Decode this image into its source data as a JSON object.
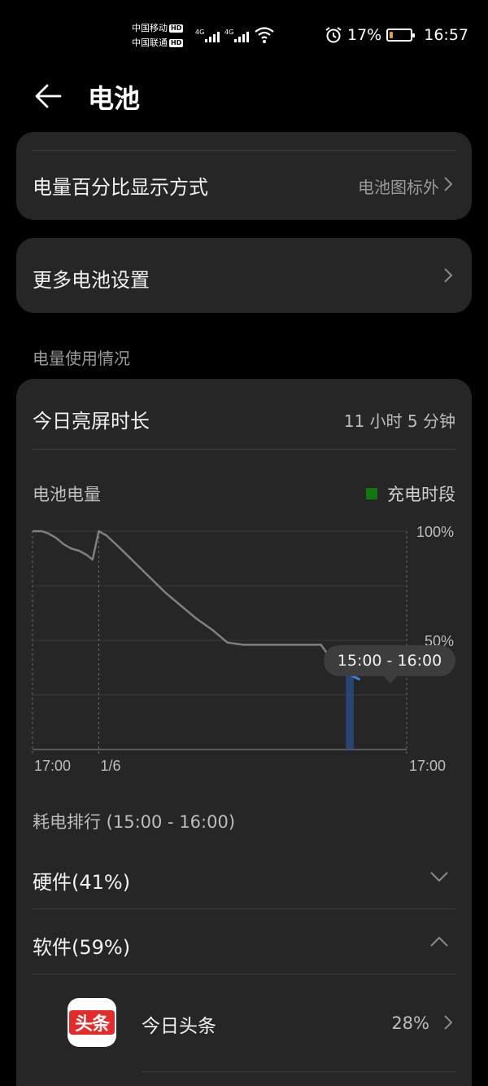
{
  "status_bar": {
    "carrier1": "中国移动",
    "carrier2": "中国联通",
    "hd_badge": "HD",
    "net_type1": "4G",
    "net_type2": "4G",
    "battery_pct": "17%",
    "battery_level": 0.17,
    "time": "16:57",
    "icons": [
      "signal-icon",
      "wifi-icon",
      "alarm-icon",
      "battery-icon"
    ]
  },
  "header": {
    "title": "电池",
    "back_icon": "back-arrow-icon"
  },
  "settings": {
    "percent_display_label": "电量百分比显示方式",
    "percent_display_value": "电池图标外",
    "more_settings_label": "更多电池设置"
  },
  "usage_section_title": "电量使用情况",
  "usage": {
    "screen_time_label": "今日亮屏时长",
    "screen_time_value": "11 小时 5 分钟",
    "chart_title": "电池电量",
    "legend_label": "充电时段",
    "tooltip": "15:00 - 16:00",
    "ranking_title": "耗电排行 (15:00 - 16:00)",
    "hardware_label": "硬件(41%)",
    "software_label": "软件(59%)",
    "apps": [
      {
        "name": "今日头条",
        "percent": "28%",
        "icon_text": "头条"
      }
    ]
  },
  "colors": {
    "background": "#000000",
    "card": "#262626",
    "charging_legend": "#0e7a0e",
    "highlight": "#2f6fd6",
    "battery_fill": "#f0a020"
  },
  "chart_data": {
    "type": "line",
    "title": "电池电量",
    "x_tick_labels": [
      "17:00",
      "1/6",
      "17:00"
    ],
    "y_tick_labels": [
      "100%",
      "50%"
    ],
    "ylim": [
      0,
      100
    ],
    "x_unit": "hours since 17:00 previous day",
    "series": [
      {
        "values": [
          [
            0,
            100
          ],
          [
            1.2,
            100
          ],
          [
            2,
            99
          ],
          [
            3,
            97
          ],
          [
            4,
            94
          ],
          [
            5,
            92
          ],
          [
            6,
            91
          ],
          [
            7,
            89
          ],
          [
            7.7,
            87
          ],
          [
            8.5,
            100
          ],
          [
            9.5,
            98
          ],
          [
            11,
            93
          ],
          [
            13,
            86
          ],
          [
            15,
            79
          ],
          [
            17,
            72
          ],
          [
            19,
            66
          ],
          [
            21,
            60
          ],
          [
            23,
            55
          ],
          [
            25,
            49
          ],
          [
            27,
            48
          ],
          [
            30,
            48
          ],
          [
            34,
            48
          ],
          [
            37,
            48
          ],
          [
            38.2,
            42
          ],
          [
            39,
            40
          ],
          [
            40,
            37
          ],
          [
            40.9,
            34
          ],
          [
            42,
            32
          ]
        ]
      }
    ],
    "highlight_range": [
      40,
      41
    ]
  }
}
